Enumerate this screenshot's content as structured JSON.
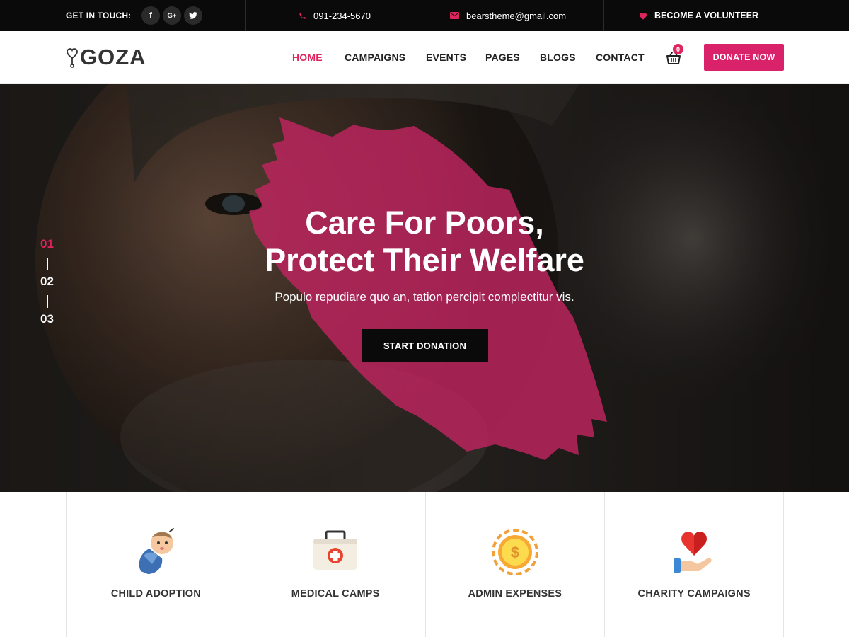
{
  "topbar": {
    "get_in_touch": "GET IN TOUCH:",
    "social": [
      {
        "icon": "facebook-icon",
        "glyph": "f"
      },
      {
        "icon": "google-plus-icon",
        "glyph": "G+"
      },
      {
        "icon": "twitter-icon",
        "glyph": "t"
      }
    ],
    "phone": "091-234-5670",
    "email": "bearstheme@gmail.com",
    "volunteer": "BECOME A VOLUNTEER"
  },
  "header": {
    "logo_text": "GOZA",
    "nav": [
      "HOME",
      "CAMPAIGNS",
      "EVENTS",
      "PAGES",
      "BLOGS",
      "CONTACT"
    ],
    "active_nav": "HOME",
    "cart_count": "0",
    "donate_label": "DONATE NOW"
  },
  "hero": {
    "slides": [
      "01",
      "02",
      "03"
    ],
    "active_slide": "01",
    "title_line1": "Care For Poors,",
    "title_line2": "Protect Their Welfare",
    "subtitle": "Populo repudiare quo an, tation percipit complectitur vis.",
    "cta_label": "START DONATION"
  },
  "features": [
    {
      "label": "CHILD ADOPTION",
      "icon": "baby-icon"
    },
    {
      "label": "MEDICAL CAMPS",
      "icon": "first-aid-kit-icon"
    },
    {
      "label": "ADMIN EXPENSES",
      "icon": "coin-icon"
    },
    {
      "label": "CHARITY CAMPAIGNS",
      "icon": "heart-hand-icon"
    }
  ],
  "colors": {
    "accent": "#e0245e",
    "button_accent": "#d9226a",
    "topbar_bg": "#0a0a0a"
  }
}
